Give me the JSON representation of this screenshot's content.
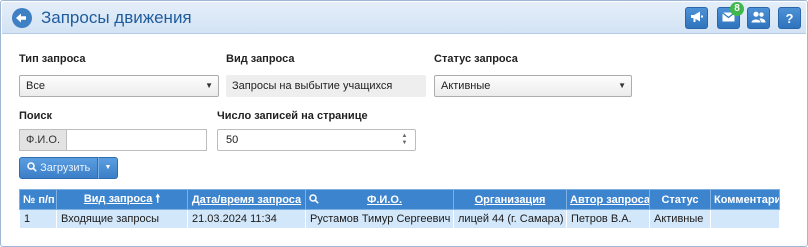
{
  "header": {
    "title": "Запросы движения",
    "messages_badge": "8"
  },
  "filters": {
    "request_type": {
      "label": "Тип запроса",
      "value": "Все"
    },
    "request_kind": {
      "label": "Вид запроса",
      "value": "Запросы на выбытие учащихся"
    },
    "request_status": {
      "label": "Статус запроса",
      "value": "Активные"
    },
    "search": {
      "label": "Поиск",
      "addon": "Ф.И.О.",
      "value": ""
    },
    "page_size": {
      "label": "Число записей на странице",
      "value": "50"
    }
  },
  "actions": {
    "load_label": "Загрузить"
  },
  "table": {
    "columns": [
      "№ п/п",
      "Вид запроса",
      "Дата/время запроса",
      "Ф.И.О.",
      "Организация",
      "Автор запроса",
      "Статус",
      "Комментарий"
    ],
    "sort_indicator": "🠕",
    "rows": [
      [
        "1",
        "Входящие запросы",
        "21.03.2024 11:34",
        "Рустамов Тимур Сергеевич",
        "лицей 44 (г. Самара)",
        "Петров В.А.",
        "Активные",
        ""
      ]
    ]
  },
  "colors": {
    "accent": "#3d84cf",
    "title": "#1f5c9e",
    "row_bg": "#d3e7fa",
    "badge": "#41b84b"
  },
  "icons": [
    "back-icon",
    "megaphone-icon",
    "envelope-icon",
    "users-icon",
    "help-icon",
    "search-icon",
    "chevron-down-icon",
    "sort-asc-icon"
  ]
}
